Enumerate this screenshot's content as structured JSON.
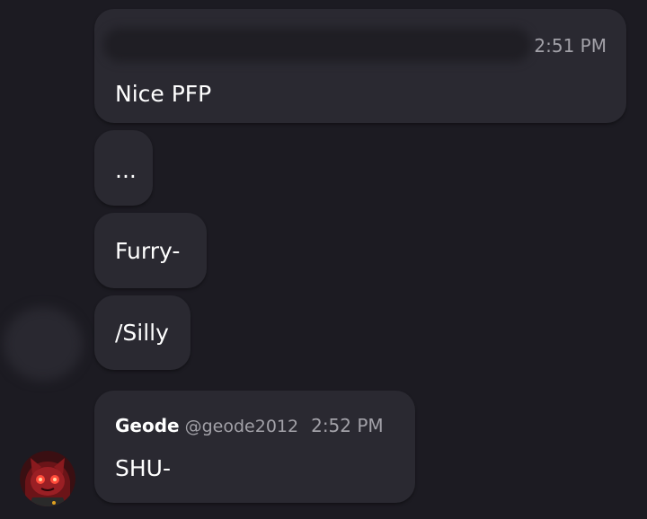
{
  "messages": [
    {
      "text": "Nice PFP",
      "time": "2:51 PM"
    },
    {
      "text": "..."
    },
    {
      "text": "Furry-"
    },
    {
      "text": "/Silly"
    },
    {
      "author": "Geode",
      "handle": "@geode2012",
      "time": "2:52 PM",
      "text": "SHU-"
    }
  ],
  "colors": {
    "background": "#1c1b22",
    "bubble": "#2a2931",
    "muted_text": "#a2a1a8"
  }
}
